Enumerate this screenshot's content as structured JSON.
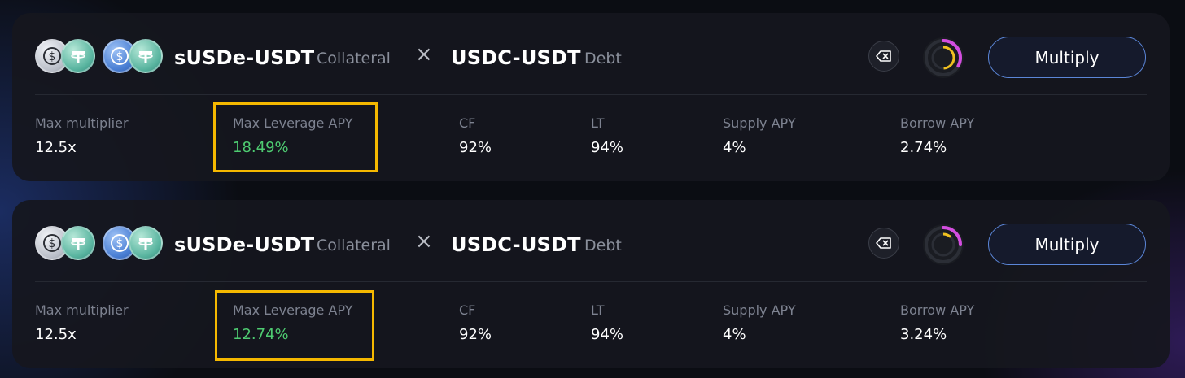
{
  "markets": [
    {
      "collateral_pair": "sUSDe-USDT",
      "collateral_tag": "Collateral",
      "times_symbol": "×",
      "debt_pair": "USDC-USDT",
      "debt_tag": "Debt",
      "multiply_label": "Multiply",
      "stats": {
        "max_multiplier_label": "Max multiplier",
        "max_multiplier_value": "12.5x",
        "max_leverage_apy_label": "Max Leverage APY",
        "max_leverage_apy_value": "18.49%",
        "cf_label": "CF",
        "cf_value": "92%",
        "lt_label": "LT",
        "lt_value": "94%",
        "supply_apy_label": "Supply APY",
        "supply_apy_value": "4%",
        "borrow_apy_label": "Borrow APY",
        "borrow_apy_value": "2.74%"
      },
      "gauge_level": 0.33
    },
    {
      "collateral_pair": "sUSDe-USDT",
      "collateral_tag": "Collateral",
      "times_symbol": "×",
      "debt_pair": "USDC-USDT",
      "debt_tag": "Debt",
      "multiply_label": "Multiply",
      "stats": {
        "max_multiplier_label": "Max multiplier",
        "max_multiplier_value": "12.5x",
        "max_leverage_apy_label": "Max Leverage APY",
        "max_leverage_apy_value": "12.74%",
        "cf_label": "CF",
        "cf_value": "92%",
        "lt_label": "LT",
        "lt_value": "94%",
        "supply_apy_label": "Supply APY",
        "supply_apy_value": "4%",
        "borrow_apy_label": "Borrow APY",
        "borrow_apy_value": "3.24%"
      },
      "gauge_level": 0.25
    }
  ],
  "icons": {
    "token_1": "susde-coin-icon",
    "token_2": "usdt-coin-icon",
    "token_3": "usdc-coin-icon",
    "action": "erase-icon",
    "gauge": "utilization-gauge-icon"
  },
  "colors": {
    "accent_green": "#4ecb71",
    "highlight_box": "#f5b800",
    "gauge_magenta": "#d44de0",
    "gauge_yellow": "#f0c020",
    "button_border": "#5b86d8"
  }
}
